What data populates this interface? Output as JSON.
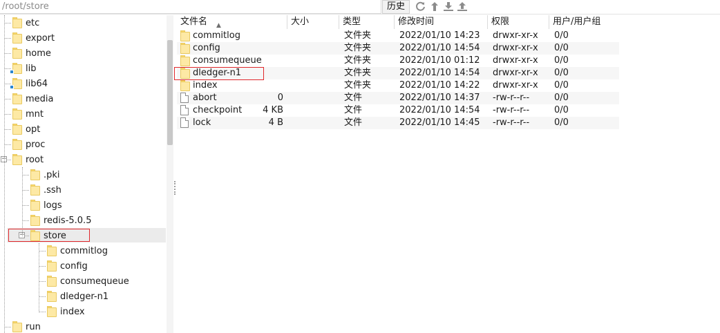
{
  "pathbar": {
    "path": "/root/store",
    "history_label": "历史",
    "tools": [
      "refresh-icon",
      "up-icon",
      "download-icon",
      "upload-icon"
    ]
  },
  "tree": {
    "items": [
      {
        "label": "etc",
        "level": 0,
        "link": false
      },
      {
        "label": "export",
        "level": 0,
        "link": false
      },
      {
        "label": "home",
        "level": 0,
        "link": false
      },
      {
        "label": "lib",
        "level": 0,
        "link": true
      },
      {
        "label": "lib64",
        "level": 0,
        "link": true
      },
      {
        "label": "media",
        "level": 0,
        "link": false
      },
      {
        "label": "mnt",
        "level": 0,
        "link": false
      },
      {
        "label": "opt",
        "level": 0,
        "link": false
      },
      {
        "label": "proc",
        "level": 0,
        "link": false
      },
      {
        "label": "root",
        "level": 0,
        "link": false,
        "expanded": true
      },
      {
        "label": ".pki",
        "level": 1,
        "link": false
      },
      {
        "label": ".ssh",
        "level": 1,
        "link": false
      },
      {
        "label": "logs",
        "level": 1,
        "link": false
      },
      {
        "label": "redis-5.0.5",
        "level": 1,
        "link": false
      },
      {
        "label": "store",
        "level": 1,
        "link": false,
        "expanded": true,
        "selected": true
      },
      {
        "label": "commitlog",
        "level": 2,
        "link": false
      },
      {
        "label": "config",
        "level": 2,
        "link": false
      },
      {
        "label": "consumequeue",
        "level": 2,
        "link": false
      },
      {
        "label": "dledger-n1",
        "level": 2,
        "link": false
      },
      {
        "label": "index",
        "level": 2,
        "link": false
      },
      {
        "label": "run",
        "level": 0,
        "link": false
      }
    ]
  },
  "list": {
    "columns": {
      "name": "文件名",
      "size": "大小",
      "type": "类型",
      "mtime": "修改时间",
      "perm": "权限",
      "owner": "用户/用户组"
    },
    "rows": [
      {
        "name": "commitlog",
        "kind": "folder",
        "size": "",
        "type": "文件夹",
        "mtime": "2022/01/10 14:23",
        "perm": "drwxr-xr-x",
        "owner": "0/0"
      },
      {
        "name": "config",
        "kind": "folder",
        "size": "",
        "type": "文件夹",
        "mtime": "2022/01/10 14:54",
        "perm": "drwxr-xr-x",
        "owner": "0/0"
      },
      {
        "name": "consumequeue",
        "kind": "folder",
        "size": "",
        "type": "文件夹",
        "mtime": "2022/01/10 01:12",
        "perm": "drwxr-xr-x",
        "owner": "0/0"
      },
      {
        "name": "dledger-n1",
        "kind": "folder",
        "size": "",
        "type": "文件夹",
        "mtime": "2022/01/10 14:54",
        "perm": "drwxr-xr-x",
        "owner": "0/0"
      },
      {
        "name": "index",
        "kind": "folder",
        "size": "",
        "type": "文件夹",
        "mtime": "2022/01/10 14:22",
        "perm": "drwxr-xr-x",
        "owner": "0/0"
      },
      {
        "name": "abort",
        "kind": "file",
        "size": "0",
        "type": "文件",
        "mtime": "2022/01/10 14:37",
        "perm": "-rw-r--r--",
        "owner": "0/0"
      },
      {
        "name": "checkpoint",
        "kind": "file",
        "size": "4 KB",
        "type": "文件",
        "mtime": "2022/01/10 14:54",
        "perm": "-rw-r--r--",
        "owner": "0/0"
      },
      {
        "name": "lock",
        "kind": "file",
        "size": "4 B",
        "type": "文件",
        "mtime": "2022/01/10 14:45",
        "perm": "-rw-r--r--",
        "owner": "0/0"
      }
    ]
  },
  "colors": {
    "highlight": "#e0262a",
    "folder": "#fde9a5",
    "selection": "#ebebeb"
  }
}
